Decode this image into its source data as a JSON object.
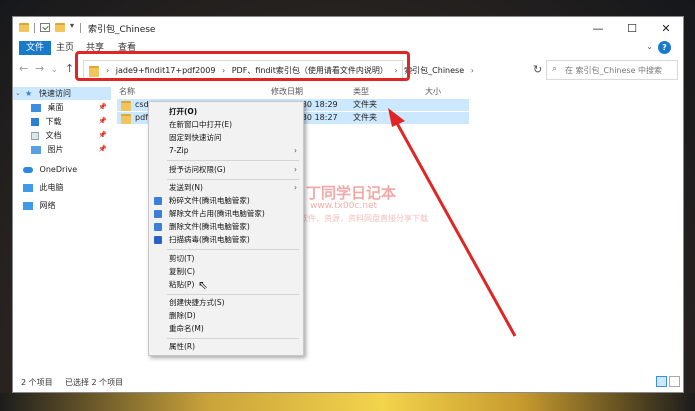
{
  "window": {
    "title": "索引包_Chinese",
    "controls": {
      "minimize": "—",
      "maximize": "☐",
      "close": "✕"
    }
  },
  "ribbon": {
    "tabs": [
      "文件",
      "主页",
      "共享",
      "查看"
    ],
    "help": "?"
  },
  "address": {
    "crumbs": [
      "jade9+findit17+pdf2009",
      "PDF、findit索引包（使用请看文件内说明）",
      "索引包_Chinese"
    ],
    "search_placeholder": "在 索引包_Chinese 中搜索"
  },
  "nav_pane": {
    "items": [
      {
        "label": "快速访问",
        "icon": "star-icon",
        "selected": true
      },
      {
        "label": "桌面",
        "icon": "desktop-icon",
        "pinned": true
      },
      {
        "label": "下载",
        "icon": "download-icon",
        "pinned": true
      },
      {
        "label": "文档",
        "icon": "document-icon",
        "pinned": true
      },
      {
        "label": "图片",
        "icon": "picture-icon",
        "pinned": true
      },
      {
        "label": "OneDrive",
        "icon": "cloud-icon"
      },
      {
        "label": "此电脑",
        "icon": "computer-icon"
      },
      {
        "label": "网络",
        "icon": "network-icon"
      }
    ]
  },
  "file_list": {
    "columns": [
      "名称",
      "修改日期",
      "类型",
      "大小"
    ],
    "rows": [
      {
        "name": "csd",
        "date": "2024/6/30 18:29",
        "type": "文件夹",
        "size": ""
      },
      {
        "name": "pdf",
        "date": "2024/6/30 18:27",
        "type": "文件夹",
        "size": ""
      }
    ]
  },
  "context_menu": {
    "items": [
      {
        "label": "打开(O)",
        "bold": true
      },
      {
        "label": "在新窗口中打开(E)"
      },
      {
        "label": "固定到快速访问"
      },
      {
        "label": "7-Zip",
        "submenu": true
      },
      {
        "label": "授予访问权限(G)",
        "submenu": true
      },
      {
        "label": "发送到(N)",
        "submenu": true
      },
      {
        "label": "粉碎文件(腾讯电脑管家)",
        "icon": "shred-icon",
        "color": "#3b7fd9"
      },
      {
        "label": "解除文件占用(腾讯电脑管家)",
        "icon": "unlock-icon",
        "color": "#3b7fd9"
      },
      {
        "label": "删除文件(腾讯电脑管家)",
        "icon": "delete-icon",
        "color": "#3b7fd9"
      },
      {
        "label": "扫描病毒(腾讯电脑管家)",
        "icon": "shield-icon",
        "color": "#2a62c9"
      },
      {
        "label": "剪切(T)"
      },
      {
        "label": "复制(C)"
      },
      {
        "label": "粘贴(P)"
      },
      {
        "label": "创建快捷方式(S)"
      },
      {
        "label": "删除(D)"
      },
      {
        "label": "重命名(M)"
      },
      {
        "label": "属性(R)"
      }
    ]
  },
  "status": {
    "count": "2 个项目",
    "selected": "已选择 2 个项目"
  },
  "watermark": {
    "line1": "丁同学日记本",
    "line2": "www.tx00c.net",
    "line3": "软件、资源，资料网盘直接分享下载"
  },
  "colors": {
    "highlight": "#e02525",
    "selection": "#cce8ff",
    "accent": "#1979ca"
  }
}
